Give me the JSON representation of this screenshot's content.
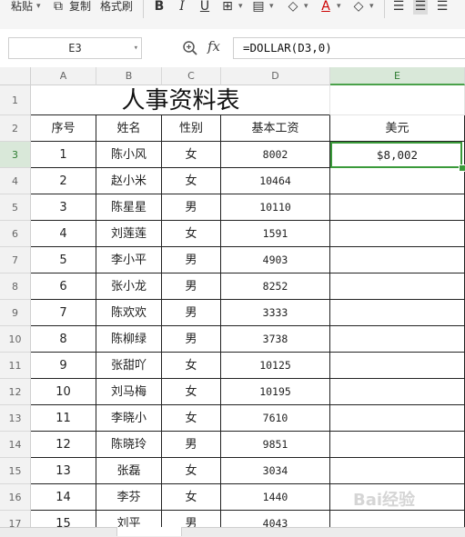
{
  "toolbar": {
    "paste": "粘贴",
    "copy": "复制",
    "format_painter": "格式刷",
    "bold": "B",
    "italic": "I",
    "underline": "U",
    "font_color": "A"
  },
  "formula_bar": {
    "name_box": "E3",
    "fx": "fx",
    "formula": "=DOLLAR(D3,0)"
  },
  "columns": [
    "A",
    "B",
    "C",
    "D",
    "E"
  ],
  "rows": [
    "1",
    "2",
    "3",
    "4",
    "5",
    "6",
    "7",
    "8",
    "9",
    "10",
    "11",
    "12",
    "13",
    "14",
    "15",
    "16",
    "17"
  ],
  "sheet": {
    "title": "人事资料表",
    "headers": [
      "序号",
      "姓名",
      "性别",
      "基本工资",
      "美元"
    ],
    "data": [
      [
        "1",
        "陈小风",
        "女",
        "8002",
        "$8,002"
      ],
      [
        "2",
        "赵小米",
        "女",
        "10464",
        ""
      ],
      [
        "3",
        "陈星星",
        "男",
        "10110",
        ""
      ],
      [
        "4",
        "刘莲莲",
        "女",
        "1591",
        ""
      ],
      [
        "5",
        "李小平",
        "男",
        "4903",
        ""
      ],
      [
        "6",
        "张小龙",
        "男",
        "8252",
        ""
      ],
      [
        "7",
        "陈欢欢",
        "男",
        "3333",
        ""
      ],
      [
        "8",
        "陈柳绿",
        "男",
        "3738",
        ""
      ],
      [
        "9",
        "张甜吖",
        "女",
        "10125",
        ""
      ],
      [
        "10",
        "刘马梅",
        "女",
        "10195",
        ""
      ],
      [
        "11",
        "李晓小",
        "女",
        "7610",
        ""
      ],
      [
        "12",
        "陈晓玲",
        "男",
        "9851",
        ""
      ],
      [
        "13",
        "张磊",
        "女",
        "3034",
        ""
      ],
      [
        "14",
        "李芬",
        "女",
        "1440",
        ""
      ],
      [
        "15",
        "刘平",
        "男",
        "4043",
        ""
      ]
    ]
  },
  "selected_cell": "E3",
  "colors": {
    "selection": "#3a9a3a",
    "header_bg": "#f2f2f2"
  },
  "watermark": "Bai经验"
}
